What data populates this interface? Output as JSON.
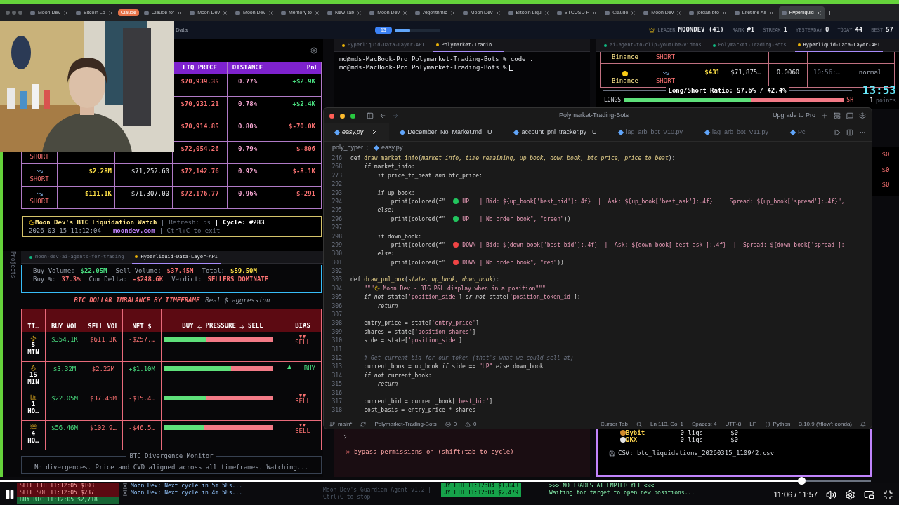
{
  "browser_tabs": [
    {
      "label": "Moon Dev",
      "selected": false
    },
    {
      "label": "Bitcoin Lo",
      "selected": false
    },
    {
      "label": "Claude",
      "selected": false,
      "kind": "group"
    },
    {
      "label": "Claude for",
      "selected": false
    },
    {
      "label": "Moon Dev",
      "selected": false
    },
    {
      "label": "Moon Dev",
      "selected": false
    },
    {
      "label": "Memory to",
      "selected": false
    },
    {
      "label": "New Tab",
      "selected": false
    },
    {
      "label": "Moon Dev",
      "selected": false
    },
    {
      "label": "Algorithmic",
      "selected": false
    },
    {
      "label": "Moon Dev",
      "selected": false
    },
    {
      "label": "Bitcoin Liqu",
      "selected": false
    },
    {
      "label": "BTCUSD P",
      "selected": false
    },
    {
      "label": "Claude",
      "selected": false
    },
    {
      "label": "Moon Dev",
      "selected": false
    },
    {
      "label": "jordan bro",
      "selected": false
    },
    {
      "label": "Lifetime All",
      "selected": false
    },
    {
      "label": "Hyperliquid",
      "selected": true
    }
  ],
  "top_bar": {
    "title": "Data",
    "badge": "13",
    "progress": {
      "level": 0.35
    },
    "stats": [
      {
        "label": "LEADER",
        "value": "MOONDEV (41)"
      },
      {
        "label": "RANK",
        "value": "#1"
      },
      {
        "label": "STREAK",
        "value": "1"
      },
      {
        "label": "YESTERDAY",
        "value": "0"
      },
      {
        "label": "TODAY",
        "value": "44"
      },
      {
        "label": "BEST",
        "value": "57"
      }
    ]
  },
  "liquidation_table": {
    "columns": [
      "LIQ PRICE",
      "DISTANCE",
      "PnL"
    ],
    "rows": [
      {
        "liq": "$70,939.35",
        "distance": "0.77%",
        "pnl": "+$2.9K",
        "color": "#4ade80"
      },
      {
        "liq": "$70,931.21",
        "distance": "0.78%",
        "pnl": "+$2.4K",
        "color": "#4ade80"
      },
      {
        "liq": "$70,914.85",
        "distance": "0.80%",
        "pnl": "$-70.0K",
        "color": "#f87171"
      },
      {
        "side": "SHORT",
        "liq": "$72,054.26",
        "distance": "0.79%",
        "pnl": "$-806",
        "color": "#f87171"
      },
      {
        "side": "SHORT",
        "size": "$2.28M",
        "entry": "$71,252.60",
        "liq": "$72,142.76",
        "distance": "0.92%",
        "pnl": "$-8.1K",
        "color": "#f87171"
      },
      {
        "side": "SHORT",
        "size": "$111.1K",
        "entry": "$71,307.00",
        "liq": "$72,176.77",
        "distance": "0.96%",
        "pnl": "$-291",
        "color": "#f87171"
      }
    ]
  },
  "liq_footer": {
    "title": "Moon Dev's BTC Liquidation Watch",
    "refresh": "Refresh: 5s",
    "cycle": "Cycle: #283",
    "timestamp": "2026-03-15 11:12:04",
    "site": "moondev.com",
    "hint": "Ctrl+C to exit"
  },
  "sidebar_label": "Projects",
  "imbalance": {
    "tabs": [
      {
        "label": "moon-dev-ai-agents-for-trading",
        "selected": false
      },
      {
        "label": "Hyperliquid-Data-Layer-API",
        "selected": true
      }
    ],
    "summary": [
      [
        {
          "label": "Buy Volume:",
          "value": "$22.05M",
          "color": "#4ade80"
        },
        {
          "label": "Sell Volume:",
          "value": "$37.45M",
          "color": "#f87171"
        },
        {
          "label": "Total:",
          "value": "$59.50M",
          "color": "#fde047"
        }
      ],
      [
        {
          "label": "Buy %:",
          "value": "37.3%",
          "color": "#f87171"
        },
        {
          "label": "Cum Delta:",
          "value": "-$248.6K",
          "color": "#f87171"
        },
        {
          "label": "Verdict:",
          "value": "SELLERS DOMINATE",
          "color": "#f87171"
        }
      ]
    ],
    "title": "BTC DOLLAR IMBALANCE BY TIMEFRAME",
    "subtitle": "Real $ aggression",
    "columns": [
      "TI…",
      "BUY VOL",
      "SELL VOL",
      "NET $"
    ],
    "pressure_header": {
      "left": "BUY",
      "middle": "PRESSURE",
      "right": "SELL"
    },
    "bias_header": "BIAS",
    "rows": [
      {
        "kind": "bolt",
        "timeframe": "5 MIN",
        "buy": "$354.1K",
        "sell": "$611.3K",
        "net": "-$257.…",
        "level": 0.39,
        "bias": {
          "label": "SELL",
          "kind": "down"
        }
      },
      {
        "kind": "fire",
        "timeframe": "15 MIN",
        "buy": "$3.32M",
        "sell": "$2.22M",
        "net": "+$1.10M",
        "level": 0.61,
        "bias": {
          "label": "BUY",
          "kind": "up"
        }
      },
      {
        "kind": "chart",
        "timeframe": "1 HO…",
        "buy": "$22.05M",
        "sell": "$37.45M",
        "net": "-$15.4…",
        "level": 0.39,
        "bias": {
          "label": "SELL",
          "kind": "down"
        }
      },
      {
        "kind": "wave",
        "timeframe": "4 HO…",
        "buy": "$56.46M",
        "sell": "$102.9…",
        "net": "-$46.5…",
        "level": 0.36,
        "bias": {
          "label": "SELL",
          "kind": "down"
        }
      }
    ]
  },
  "divergence": {
    "title": "BTC Divergence Monitor",
    "message": "No divergences. Price and CVD aligned across all timeframes. Watching..."
  },
  "middle_terminal": {
    "tabs": [
      {
        "label": "Hyperliquid-Data-Layer-API",
        "selected": false
      },
      {
        "label": "Polymarket-Tradin...",
        "selected": true
      }
    ],
    "lines": [
      "md@mds-MacBook-Pro Polymarket-Trading-Bots % code .",
      "md@mds-MacBook-Pro Polymarket-Trading-Bots %"
    ]
  },
  "right_terminal": {
    "tabs": [
      {
        "label": "ai-agent-to-clip-youtube-videos",
        "selected": false
      },
      {
        "label": "Polymarket-Trading-Bots",
        "selected": false
      },
      {
        "label": "Hyperliquid-Data-Layer-API",
        "selected": true
      }
    ],
    "rows": [
      {
        "exchange": "Binance",
        "side": "SHORT"
      },
      {
        "exchange": "Binance",
        "side": "SHORT",
        "size": "$431",
        "price": "$71,875…",
        "qty": "0.0060",
        "time": "10:56:…",
        "type": "normal"
      }
    ],
    "ratio": {
      "title": "Long/Short Ratio: 57.6% / 42.4%",
      "long_label": "LONGS",
      "short_label": "SH",
      "level": 0.576
    },
    "clock": "13:53",
    "points_value": "1",
    "points_label": "points",
    "side_values": [
      "$0",
      "$0",
      "$0"
    ]
  },
  "editor": {
    "title": "Polymarket-Trading-Bots",
    "upgrade": "Upgrade to Pro",
    "tabs": [
      {
        "label": "easy.py",
        "selected": true
      },
      {
        "label": "December_No_Market.md",
        "badge": "U",
        "selected": false
      },
      {
        "label": "account_pnl_tracker.py",
        "badge": "U",
        "selected": false
      },
      {
        "label": "lag_arb_bot_V10.py",
        "selected": false
      },
      {
        "label": "lag_arb_bot_V11.py",
        "selected": false
      },
      {
        "label": "Pc",
        "selected": false
      }
    ],
    "breadcrumb": [
      "poly_hyper",
      "easy.py"
    ],
    "lines": [
      {
        "n": "246",
        "s": [
          {
            "kind": "kw",
            "t": "def "
          },
          {
            "kind": "fn",
            "t": "draw_market_info"
          },
          {
            "kind": "txt",
            "t": "("
          },
          {
            "kind": "par",
            "t": "market_info, time_remaining, up_book, down_book, btc_price, price_to_beat"
          },
          {
            "kind": "txt",
            "t": "):"
          }
        ]
      },
      {
        "n": "268",
        "s": [
          {
            "kind": "ctl",
            "t": "    if "
          },
          {
            "kind": "txt",
            "t": "market_info:"
          }
        ]
      },
      {
        "n": "273",
        "s": [
          {
            "kind": "ctl",
            "t": "        if "
          },
          {
            "kind": "txt",
            "t": "price_to_beat "
          },
          {
            "kind": "ctl",
            "t": "and "
          },
          {
            "kind": "txt",
            "t": "btc_price:"
          }
        ]
      },
      {
        "n": "292"
      },
      {
        "n": "293",
        "s": [
          {
            "kind": "ctl",
            "t": "        if "
          },
          {
            "kind": "txt",
            "t": "up_book:"
          }
        ]
      },
      {
        "n": "294",
        "s": [
          {
            "kind": "txt",
            "t": "            print(colored(f\"  "
          },
          {
            "kind": "dot",
            "color": "#22c55e"
          },
          {
            "kind": "str",
            "t": " UP   | Bid: ${up_book['best_bid']:.4f}  |  Ask: ${up_book['best_ask']:.4f}  |  Spread: ${up_book['spread']:.4f}\","
          }
        ]
      },
      {
        "n": "295",
        "s": [
          {
            "kind": "ctl",
            "t": "        else:"
          }
        ]
      },
      {
        "n": "296",
        "s": [
          {
            "kind": "txt",
            "t": "            print(colored(f\"  "
          },
          {
            "kind": "dot",
            "color": "#22c55e"
          },
          {
            "kind": "str",
            "t": " UP   | No order book\", \"green\""
          },
          {
            "kind": "txt",
            "t": "))"
          }
        ]
      },
      {
        "n": "297"
      },
      {
        "n": "298",
        "s": [
          {
            "kind": "ctl",
            "t": "        if "
          },
          {
            "kind": "txt",
            "t": "down_book:"
          }
        ]
      },
      {
        "n": "299",
        "s": [
          {
            "kind": "txt",
            "t": "            print(colored(f\"  "
          },
          {
            "kind": "dot",
            "color": "#ef4444"
          },
          {
            "kind": "str",
            "t": " DOWN | Bid: ${down_book['best_bid']:.4f}  |  Ask: ${down_book['best_ask']:.4f}  |  Spread: ${down_book['spread']:"
          }
        ]
      },
      {
        "n": "300",
        "s": [
          {
            "kind": "ctl",
            "t": "        else:"
          }
        ]
      },
      {
        "n": "301",
        "s": [
          {
            "kind": "txt",
            "t": "            print(colored(f\"  "
          },
          {
            "kind": "dot",
            "color": "#ef4444"
          },
          {
            "kind": "str",
            "t": " DOWN | No order book\", \"red\""
          },
          {
            "kind": "txt",
            "t": "))"
          }
        ]
      },
      {
        "n": "302"
      },
      {
        "n": "303",
        "s": [
          {
            "kind": "kw",
            "t": "def "
          },
          {
            "kind": "fn",
            "t": "draw_pnl_box"
          },
          {
            "kind": "txt",
            "t": "("
          },
          {
            "kind": "par",
            "t": "state, up_book, down_book"
          },
          {
            "kind": "txt",
            "t": "):"
          }
        ]
      },
      {
        "n": "304",
        "s": [
          {
            "kind": "str",
            "t": "    \"\"\""
          },
          {
            "kind": "moon"
          },
          {
            "kind": "str",
            "t": " Moon Dev - BIG P&L display when in a position\"\"\""
          }
        ]
      },
      {
        "n": "305",
        "s": [
          {
            "kind": "ctl",
            "t": "    if not "
          },
          {
            "kind": "txt",
            "t": "state["
          },
          {
            "kind": "str",
            "t": "'position_side'"
          },
          {
            "kind": "txt",
            "t": "] "
          },
          {
            "kind": "ctl",
            "t": "or not "
          },
          {
            "kind": "txt",
            "t": "state["
          },
          {
            "kind": "str",
            "t": "'position_token_id'"
          },
          {
            "kind": "txt",
            "t": "]:"
          }
        ]
      },
      {
        "n": "306",
        "s": [
          {
            "kind": "ctl",
            "t": "        return"
          }
        ]
      },
      {
        "n": "307"
      },
      {
        "n": "308",
        "s": [
          {
            "kind": "txt",
            "t": "    entry_price = state["
          },
          {
            "kind": "str",
            "t": "'entry_price'"
          },
          {
            "kind": "txt",
            "t": "]"
          }
        ]
      },
      {
        "n": "309",
        "s": [
          {
            "kind": "txt",
            "t": "    shares = state["
          },
          {
            "kind": "str",
            "t": "'position_shares'"
          },
          {
            "kind": "txt",
            "t": "]"
          }
        ]
      },
      {
        "n": "310",
        "s": [
          {
            "kind": "txt",
            "t": "    side = state["
          },
          {
            "kind": "str",
            "t": "'position_side'"
          },
          {
            "kind": "txt",
            "t": "]"
          }
        ]
      },
      {
        "n": "311"
      },
      {
        "n": "312",
        "s": [
          {
            "kind": "com",
            "t": "    # Get current bid for our token (that's what we could sell at)"
          }
        ]
      },
      {
        "n": "313",
        "s": [
          {
            "kind": "txt",
            "t": "    current_book = up_book "
          },
          {
            "kind": "ctl",
            "t": "if "
          },
          {
            "kind": "txt",
            "t": "side == "
          },
          {
            "kind": "str",
            "t": "\"UP\""
          },
          {
            "kind": "ctl",
            "t": " else "
          },
          {
            "kind": "txt",
            "t": "down_book"
          }
        ]
      },
      {
        "n": "314",
        "s": [
          {
            "kind": "ctl",
            "t": "    if not "
          },
          {
            "kind": "txt",
            "t": "current_book:"
          }
        ]
      },
      {
        "n": "315",
        "s": [
          {
            "kind": "ctl",
            "t": "        return"
          }
        ]
      },
      {
        "n": "316"
      },
      {
        "n": "317",
        "s": [
          {
            "kind": "txt",
            "t": "    current_bid = current_book["
          },
          {
            "kind": "str",
            "t": "'best_bid'"
          },
          {
            "kind": "txt",
            "t": "]"
          }
        ]
      },
      {
        "n": "318",
        "s": [
          {
            "kind": "txt",
            "t": "    cost_basis = entry_price * shares"
          }
        ]
      }
    ],
    "status": {
      "branch": "main*",
      "project": "Polymarket-Trading-Bots",
      "errors": "0",
      "warnings": "0",
      "items": [
        "Cursor Tab",
        "Ln 113, Col 1",
        "Spaces: 4",
        "UTF-8",
        "LF",
        "Python",
        "3.10.9 ('tflow': conda)"
      ]
    }
  },
  "claude_terminal": {
    "notice": "bypass permissions on (shift+tab to cycle)"
  },
  "exchange_panel": {
    "exchanges": [
      {
        "name": "Bybit",
        "count": "0 liqs",
        "amount": "$0",
        "color": "#d08a2c"
      },
      {
        "name": "OKX",
        "count": "0 liqs",
        "amount": "$0",
        "color": "#e5e5e5"
      }
    ],
    "csv": "CSV: btc_liquidations_20260315_110942.csv"
  },
  "bottom_strip": {
    "trades": [
      {
        "text": "SELL ETH 11:12:05 $103",
        "kind": "sell"
      },
      {
        "text": "SELL SOL 11:12:05 $237",
        "kind": "sell"
      },
      {
        "text": "BUY BTC 11:12:05 $2,718",
        "kind": "buy"
      }
    ],
    "cycles": [
      "Moon Dev: Next cycle in 5m 58s...",
      "Moon Dev: Next cycle in 4m 58s..."
    ],
    "guardian": "Moon Dev's Guardian Agent v1.2 | Ctrl+C to stop",
    "fills": [
      "JY ETH 11:12:04 $1,043",
      "JY ETH 11:12:04 $2,479"
    ],
    "notice": [
      ">>> NO TRADES ATTEMPTED YET <<<",
      "Waiting for target to open new positions..."
    ]
  },
  "player": {
    "level": 0.92,
    "time": "11:06 / 11:57"
  }
}
